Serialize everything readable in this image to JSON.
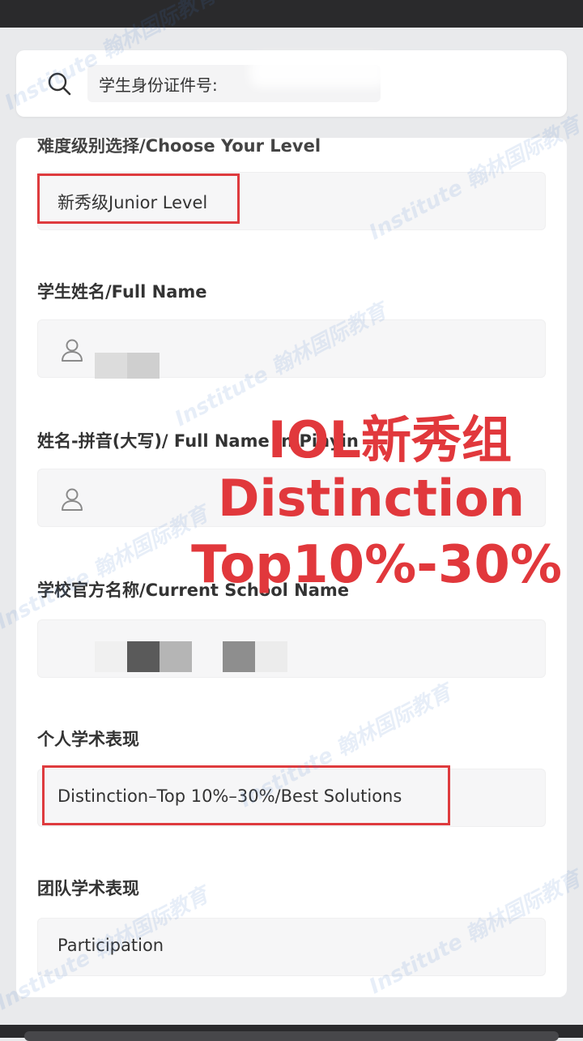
{
  "search": {
    "placeholder": "学生身份证件号:"
  },
  "form": {
    "level": {
      "label": "难度级别选择/Choose Your Level",
      "value": "新秀级Junior Level"
    },
    "full_name": {
      "label": "学生姓名/Full Name"
    },
    "pinyin_name": {
      "label": "姓名-拼音(大写)/ Full Name in Pinyin"
    },
    "school": {
      "label": "学校官方名称/Current School Name"
    },
    "individual": {
      "label": "个人学术表现",
      "value": "Distinction–Top 10%–30%/Best Solutions"
    },
    "team": {
      "label": "团队学术表现",
      "value": "Participation"
    }
  },
  "overlay": {
    "line1": "IOL新秀组",
    "line2": "Distinction",
    "line3": "Top10%-30%"
  },
  "watermark": {
    "text": "Institute 翰林国际教育"
  },
  "colors": {
    "highlight_red": "#de3b3e",
    "overlay_red": "#e1383c",
    "field_bg": "#f6f6f7"
  },
  "icons": [
    "search-icon",
    "person-icon"
  ]
}
